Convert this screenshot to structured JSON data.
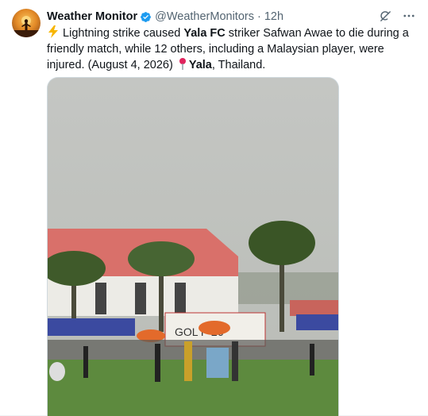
{
  "author": {
    "name": "Weather Monitor",
    "handle": "@WeatherMonitors",
    "separator": "·",
    "time": "12h"
  },
  "icons": {
    "avatar": "silhouette-sunset-icon",
    "verified": "verified-badge-icon",
    "grok": "grok-icon",
    "more": "more-options-icon",
    "lightning": "lightning-emoji",
    "pin": "pin-emoji"
  },
  "colors": {
    "verified_blue": "#1d9bf0",
    "secondary_text": "#536471",
    "field_green": "#5d8a3e"
  },
  "tweet": {
    "emoji_lightning": "⚡",
    "part1": " Lightning strike caused ",
    "bold1": "Yala FC",
    "part2": " striker Safwan Awae to die during a friendly match, while 12 others, including a Malaysian player, were injured. (August 4, 2026) ",
    "emoji_pin": "📍",
    "bold2": "Yala",
    "part3": ", Thailand."
  },
  "media": {
    "banner_text": "GOL      P 26'"
  }
}
